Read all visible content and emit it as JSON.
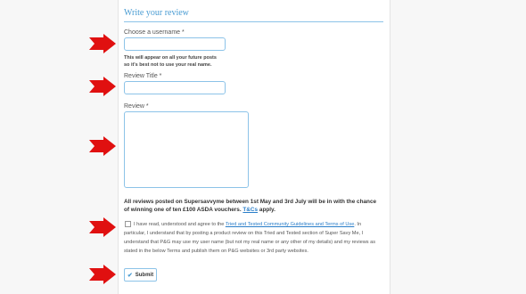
{
  "form": {
    "title": "Write your review",
    "username": {
      "label": "Choose a username *",
      "value": "",
      "placeholder": ""
    },
    "username_hint_1": "This will appear on all your future posts",
    "username_hint_2": "so it's best not to use your real name.",
    "review_title": {
      "label": "Review Title *",
      "value": "",
      "placeholder": ""
    },
    "review": {
      "label": "Review *",
      "value": "",
      "placeholder": ""
    },
    "promo_text": "All reviews posted on Supersavvyme between 1st May and 3rd July will be in with the chance of winning one of ten £100 ASDA vouchers.",
    "promo_link": "T&Cs",
    "promo_end": " apply.",
    "agree_prefix": "I have read, understood and agree to the ",
    "agree_link": "Tried and Tested Community Guidelines and Terms of Use",
    "agree_text": ". In particular, I understand that by posting a product review on this Tried and Tested section of Super Savy Me, I understand that P&G may use my user name (but not my real name or any other of my details) and my reviews as stated in the below Terms and publish them on P&G websites or 3rd party websites.",
    "submit_label": "Submit",
    "submit_icon": "check-icon"
  },
  "annotations": {
    "arrow_color": "#e01010",
    "arrow_icon": "right-arrow-icon"
  }
}
